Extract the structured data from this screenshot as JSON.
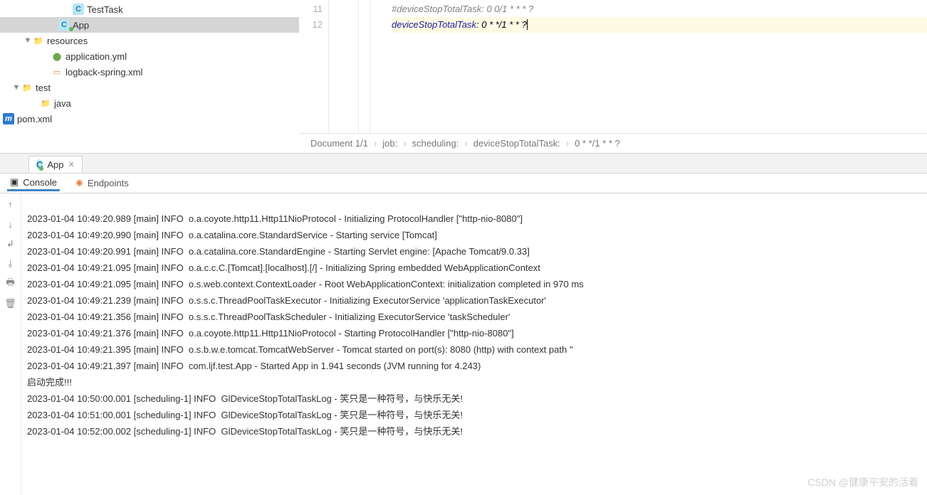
{
  "tree": {
    "testTask": "TestTask",
    "app": "App",
    "resources": "resources",
    "applicationYml": "application.yml",
    "logbackXml": "logback-spring.xml",
    "test": "test",
    "java": "java",
    "pomXml": "pom.xml"
  },
  "editor": {
    "line11_num": "11",
    "line12_num": "12",
    "line11_text": "#deviceStopTotalTask: 0 0/1 * * * ?",
    "line12_key": "deviceStopTotalTask",
    "line12_val": ": 0 * */1 * * ?"
  },
  "breadcrumb": {
    "doc": "Document 1/1",
    "b1": "job:",
    "b2": "scheduling:",
    "b3": "deviceStopTotalTask:",
    "b4": "0 * */1 * * ?"
  },
  "runTab": {
    "label": "App"
  },
  "subTabs": {
    "console": "Console",
    "endpoints": "Endpoints"
  },
  "console": {
    "l1": "2023-01-04 10:49:20.989 [main] INFO  o.a.coyote.http11.Http11NioProtocol - Initializing ProtocolHandler [\"http-nio-8080\"]",
    "l2": "2023-01-04 10:49:20.990 [main] INFO  o.a.catalina.core.StandardService - Starting service [Tomcat]",
    "l3": "2023-01-04 10:49:20.991 [main] INFO  o.a.catalina.core.StandardEngine - Starting Servlet engine: [Apache Tomcat/9.0.33]",
    "l4": "2023-01-04 10:49:21.095 [main] INFO  o.a.c.c.C.[Tomcat].[localhost].[/] - Initializing Spring embedded WebApplicationContext",
    "l5": "2023-01-04 10:49:21.095 [main] INFO  o.s.web.context.ContextLoader - Root WebApplicationContext: initialization completed in 970 ms",
    "l6": "2023-01-04 10:49:21.239 [main] INFO  o.s.s.c.ThreadPoolTaskExecutor - Initializing ExecutorService 'applicationTaskExecutor'",
    "l7": "2023-01-04 10:49:21.356 [main] INFO  o.s.s.c.ThreadPoolTaskScheduler - Initializing ExecutorService 'taskScheduler'",
    "l8": "2023-01-04 10:49:21.376 [main] INFO  o.a.coyote.http11.Http11NioProtocol - Starting ProtocolHandler [\"http-nio-8080\"]",
    "l9": "2023-01-04 10:49:21.395 [main] INFO  o.s.b.w.e.tomcat.TomcatWebServer - Tomcat started on port(s): 8080 (http) with context path ''",
    "l10": "2023-01-04 10:49:21.397 [main] INFO  com.ljf.test.App - Started App in 1.941 seconds (JVM running for 4.243)",
    "l11": "启动完成!!!",
    "l12": "2023-01-04 10:50:00.001 [scheduling-1] INFO  GlDeviceStopTotalTaskLog - 笑只是一种符号，与快乐无关!",
    "l13": "2023-01-04 10:51:00.001 [scheduling-1] INFO  GlDeviceStopTotalTaskLog - 笑只是一种符号，与快乐无关!",
    "l14": "2023-01-04 10:52:00.002 [scheduling-1] INFO  GlDeviceStopTotalTaskLog - 笑只是一种符号，与快乐无关!"
  },
  "watermark": "CSDN @健康平安的活着"
}
